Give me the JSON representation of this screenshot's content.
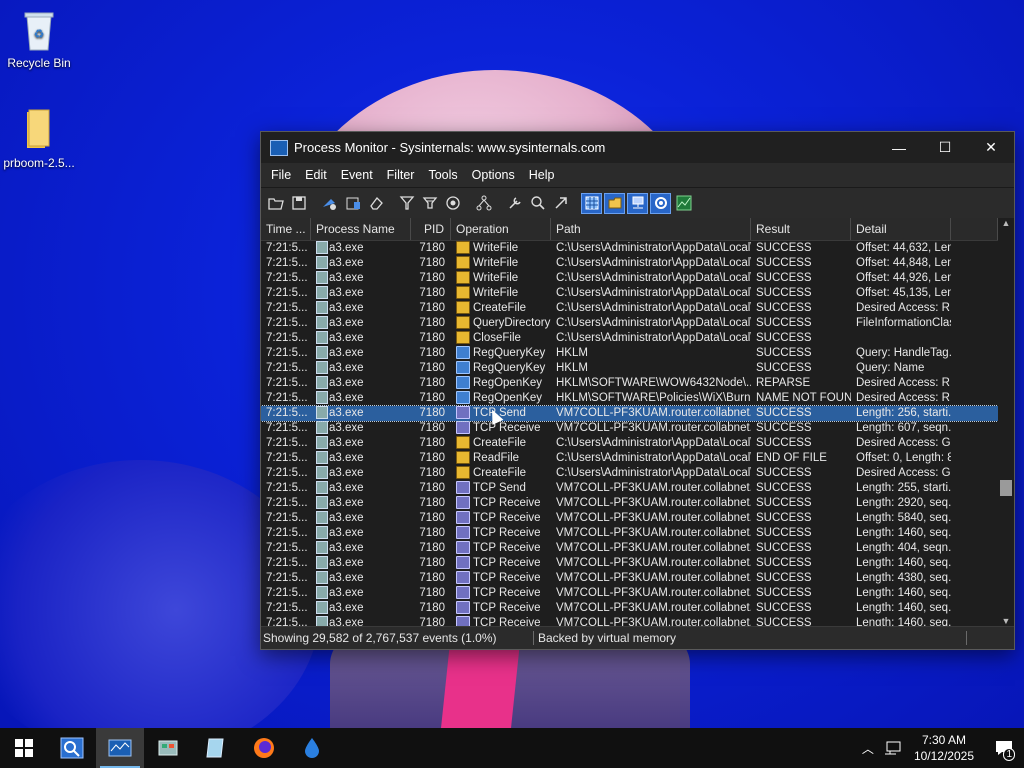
{
  "desktop": {
    "icons": [
      {
        "label": "Recycle Bin"
      },
      {
        "label": "prboom-2.5..."
      }
    ]
  },
  "window": {
    "title": "Process Monitor - Sysinternals: www.sysinternals.com",
    "controls": {
      "minimize": "—",
      "maximize": "☐",
      "close": "✕"
    },
    "menu": [
      "File",
      "Edit",
      "Event",
      "Filter",
      "Tools",
      "Options",
      "Help"
    ],
    "toolbar_icons": [
      "open-icon",
      "save-icon",
      "capture-icon",
      "autoscroll-icon",
      "clear-icon",
      "filter-icon",
      "highlight-icon",
      "include-process-icon",
      "process-tree-icon",
      "properties-icon",
      "find-icon",
      "jump-icon",
      "registry-activity-icon",
      "filesystem-activity-icon",
      "network-activity-icon",
      "process-activity-icon",
      "profiling-icon"
    ],
    "columns": [
      "Time ...",
      "Process Name",
      "PID",
      "Operation",
      "Path",
      "Result",
      "Detail"
    ],
    "rows": [
      {
        "time": "7:21:5...",
        "proc": "a3.exe",
        "pid": "7180",
        "op": "WriteFile",
        "type": "file",
        "path": "C:\\Users\\Administrator\\AppData\\Local\\...",
        "res": "SUCCESS",
        "det": "Offset: 44,632, Len..."
      },
      {
        "time": "7:21:5...",
        "proc": "a3.exe",
        "pid": "7180",
        "op": "WriteFile",
        "type": "file",
        "path": "C:\\Users\\Administrator\\AppData\\Local\\...",
        "res": "SUCCESS",
        "det": "Offset: 44,848, Len..."
      },
      {
        "time": "7:21:5...",
        "proc": "a3.exe",
        "pid": "7180",
        "op": "WriteFile",
        "type": "file",
        "path": "C:\\Users\\Administrator\\AppData\\Local\\...",
        "res": "SUCCESS",
        "det": "Offset: 44,926, Len..."
      },
      {
        "time": "7:21:5...",
        "proc": "a3.exe",
        "pid": "7180",
        "op": "WriteFile",
        "type": "file",
        "path": "C:\\Users\\Administrator\\AppData\\Local\\...",
        "res": "SUCCESS",
        "det": "Offset: 45,135, Len..."
      },
      {
        "time": "7:21:5...",
        "proc": "a3.exe",
        "pid": "7180",
        "op": "CreateFile",
        "type": "file",
        "path": "C:\\Users\\Administrator\\AppData\\Local\\...",
        "res": "SUCCESS",
        "det": "Desired Access: R..."
      },
      {
        "time": "7:21:5...",
        "proc": "a3.exe",
        "pid": "7180",
        "op": "QueryDirectory",
        "type": "file",
        "path": "C:\\Users\\Administrator\\AppData\\Local\\...",
        "res": "SUCCESS",
        "det": "FileInformationClas..."
      },
      {
        "time": "7:21:5...",
        "proc": "a3.exe",
        "pid": "7180",
        "op": "CloseFile",
        "type": "file",
        "path": "C:\\Users\\Administrator\\AppData\\Local\\...",
        "res": "SUCCESS",
        "det": ""
      },
      {
        "time": "7:21:5...",
        "proc": "a3.exe",
        "pid": "7180",
        "op": "RegQueryKey",
        "type": "reg",
        "path": "HKLM",
        "res": "SUCCESS",
        "det": "Query: HandleTag..."
      },
      {
        "time": "7:21:5...",
        "proc": "a3.exe",
        "pid": "7180",
        "op": "RegQueryKey",
        "type": "reg",
        "path": "HKLM",
        "res": "SUCCESS",
        "det": "Query: Name"
      },
      {
        "time": "7:21:5...",
        "proc": "a3.exe",
        "pid": "7180",
        "op": "RegOpenKey",
        "type": "reg",
        "path": "HKLM\\SOFTWARE\\WOW6432Node\\...",
        "res": "REPARSE",
        "det": "Desired Access: R..."
      },
      {
        "time": "7:21:5...",
        "proc": "a3.exe",
        "pid": "7180",
        "op": "RegOpenKey",
        "type": "reg",
        "path": "HKLM\\SOFTWARE\\Policies\\WiX\\Burn",
        "res": "NAME NOT FOUND",
        "det": "Desired Access: R..."
      },
      {
        "time": "7:21:5...",
        "proc": "a3.exe",
        "pid": "7180",
        "op": "TCP Send",
        "type": "net",
        "path": "VM7COLL-PF3KUAM.router.collabnet.lo...",
        "res": "SUCCESS",
        "det": "Length: 256, starti...",
        "selected": true
      },
      {
        "time": "7:21:5...",
        "proc": "a3.exe",
        "pid": "7180",
        "op": "TCP Receive",
        "type": "net",
        "path": "VM7COLL-PF3KUAM.router.collabnet.lo...",
        "res": "SUCCESS",
        "det": "Length: 607, seqn..."
      },
      {
        "time": "7:21:5...",
        "proc": "a3.exe",
        "pid": "7180",
        "op": "CreateFile",
        "type": "file",
        "path": "C:\\Users\\Administrator\\AppData\\Local\\...",
        "res": "SUCCESS",
        "det": "Desired Access: G..."
      },
      {
        "time": "7:21:5...",
        "proc": "a3.exe",
        "pid": "7180",
        "op": "ReadFile",
        "type": "file",
        "path": "C:\\Users\\Administrator\\AppData\\Local\\...",
        "res": "END OF FILE",
        "det": "Offset: 0, Length: 8..."
      },
      {
        "time": "7:21:5...",
        "proc": "a3.exe",
        "pid": "7180",
        "op": "CreateFile",
        "type": "file",
        "path": "C:\\Users\\Administrator\\AppData\\Local\\...",
        "res": "SUCCESS",
        "det": "Desired Access: G..."
      },
      {
        "time": "7:21:5...",
        "proc": "a3.exe",
        "pid": "7180",
        "op": "TCP Send",
        "type": "net",
        "path": "VM7COLL-PF3KUAM.router.collabnet.lo...",
        "res": "SUCCESS",
        "det": "Length: 255, starti..."
      },
      {
        "time": "7:21:5...",
        "proc": "a3.exe",
        "pid": "7180",
        "op": "TCP Receive",
        "type": "net",
        "path": "VM7COLL-PF3KUAM.router.collabnet.lo...",
        "res": "SUCCESS",
        "det": "Length: 2920, seq..."
      },
      {
        "time": "7:21:5...",
        "proc": "a3.exe",
        "pid": "7180",
        "op": "TCP Receive",
        "type": "net",
        "path": "VM7COLL-PF3KUAM.router.collabnet.lo...",
        "res": "SUCCESS",
        "det": "Length: 5840, seq..."
      },
      {
        "time": "7:21:5...",
        "proc": "a3.exe",
        "pid": "7180",
        "op": "TCP Receive",
        "type": "net",
        "path": "VM7COLL-PF3KUAM.router.collabnet.lo...",
        "res": "SUCCESS",
        "det": "Length: 1460, seq..."
      },
      {
        "time": "7:21:5...",
        "proc": "a3.exe",
        "pid": "7180",
        "op": "TCP Receive",
        "type": "net",
        "path": "VM7COLL-PF3KUAM.router.collabnet.lo...",
        "res": "SUCCESS",
        "det": "Length: 404, seqn..."
      },
      {
        "time": "7:21:5...",
        "proc": "a3.exe",
        "pid": "7180",
        "op": "TCP Receive",
        "type": "net",
        "path": "VM7COLL-PF3KUAM.router.collabnet.lo...",
        "res": "SUCCESS",
        "det": "Length: 1460, seq..."
      },
      {
        "time": "7:21:5...",
        "proc": "a3.exe",
        "pid": "7180",
        "op": "TCP Receive",
        "type": "net",
        "path": "VM7COLL-PF3KUAM.router.collabnet.lo...",
        "res": "SUCCESS",
        "det": "Length: 4380, seq..."
      },
      {
        "time": "7:21:5...",
        "proc": "a3.exe",
        "pid": "7180",
        "op": "TCP Receive",
        "type": "net",
        "path": "VM7COLL-PF3KUAM.router.collabnet.lo...",
        "res": "SUCCESS",
        "det": "Length: 1460, seq..."
      },
      {
        "time": "7:21:5...",
        "proc": "a3.exe",
        "pid": "7180",
        "op": "TCP Receive",
        "type": "net",
        "path": "VM7COLL-PF3KUAM.router.collabnet.lo...",
        "res": "SUCCESS",
        "det": "Length: 1460, seq..."
      },
      {
        "time": "7:21:5...",
        "proc": "a3.exe",
        "pid": "7180",
        "op": "TCP Receive",
        "type": "net",
        "path": "VM7COLL-PF3KUAM.router.collabnet.lo...",
        "res": "SUCCESS",
        "det": "Length: 1460, seq..."
      }
    ],
    "status": {
      "events": "Showing 29,582 of 2,767,537 events (1.0%)",
      "memory": "Backed by virtual memory"
    }
  },
  "taskbar": {
    "apps": [
      "start-icon",
      "search-icon",
      "process-monitor-icon",
      "control-panel-icon",
      "notepad-icon",
      "firefox-icon",
      "water-drop-icon"
    ],
    "time": "7:30 AM",
    "date": "10/12/2025",
    "notifications": "1"
  }
}
